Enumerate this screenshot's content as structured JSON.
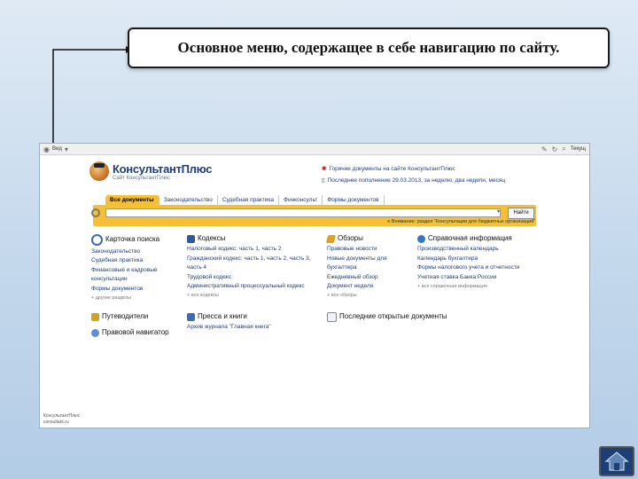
{
  "caption": "Основное меню, содержащее в себе навигацию по сайту.",
  "browser": {
    "chrome_left": "Вид",
    "chrome_right": "Текущ",
    "logo_title": "КонсультантПлюс",
    "logo_sub": "Сайт КонсультантПлюс",
    "news": [
      "Горячие документы на сайте КонсультантПлюс",
      "Последнее пополнение 29.03.2013, за неделю, два недели, месяц"
    ],
    "tabs": [
      "Все документы",
      "Законодательство",
      "Судебная практика",
      "Финконсульт",
      "Формы документов"
    ],
    "search_button": "Найти",
    "notice": "Внимание: раздел \"Консультации для бюджетных организаций\""
  },
  "sections": [
    {
      "title": "Карточка поиска",
      "links": [
        "Законодательство",
        "Судебная практика",
        "Финансовые и кадровые консультации",
        "Формы документов"
      ],
      "more": "+ другие разделы"
    },
    {
      "title": "Кодексы",
      "links": [
        "Налоговый кодекс: часть 1, часть 2",
        "Гражданский кодекс: часть 1, часть 2, часть 3, часть 4",
        "Трудовой кодекс",
        "Административный процессуальный кодекс"
      ],
      "more": "+ все кодексы"
    },
    {
      "title": "Обзоры",
      "links": [
        "Правовые новости",
        "Новые документы для бухгалтера",
        "Ежедневный обзор",
        "Документ недели"
      ],
      "more": "+ все обзоры"
    },
    {
      "title": "Справочная информация",
      "links": [
        "Производственный календарь",
        "Календарь бухгалтера",
        "Формы налогового учета и отчетности",
        "Учетная ставка Банка России"
      ],
      "more": "+ вся справочная информация"
    },
    {
      "title": "Путеводители",
      "links": [],
      "more": ""
    },
    {
      "title": "Пресса и книги",
      "links": [
        "Архив журнала \"Главная книга\""
      ],
      "more": ""
    },
    {
      "title": "Последние открытые документы",
      "links": [],
      "more": ""
    },
    {
      "title": "Правовой навигатор",
      "links": [],
      "more": ""
    }
  ],
  "footer": [
    "КонсультантПлюс",
    "consultant.ru"
  ],
  "colors": {
    "accent": "#f6c035",
    "link": "#1e3d7a",
    "home_button": "#1e3f73"
  }
}
